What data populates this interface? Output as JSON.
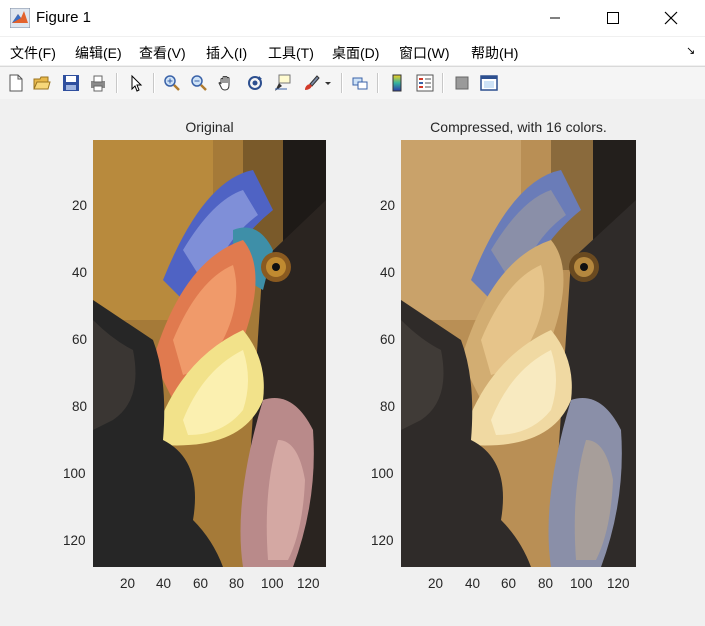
{
  "window": {
    "title": "Figure 1"
  },
  "menu": {
    "items": [
      "文件(F)",
      "编辑(E)",
      "查看(V)",
      "插入(I)",
      "工具(T)",
      "桌面(D)",
      "窗口(W)",
      "帮助(H)"
    ]
  },
  "toolbar": {
    "buttons": [
      "new-figure-icon",
      "open-file-icon",
      "save-icon",
      "print-icon",
      "select-arrow-icon",
      "zoom-in-icon",
      "zoom-out-icon",
      "pan-hand-icon",
      "rotate-3d-icon",
      "data-cursor-icon",
      "brush-icon",
      "link-plot-icon",
      "colorbar-icon",
      "legend-icon",
      "hide-plot-tools-icon",
      "show-plot-tools-icon"
    ]
  },
  "axes_left": {
    "title": "Original",
    "yticks": [
      "20",
      "40",
      "60",
      "80",
      "100",
      "120"
    ],
    "xticks": [
      "20",
      "40",
      "60",
      "80",
      "100",
      "120"
    ]
  },
  "axes_right": {
    "title": "Compressed, with 16 colors.",
    "yticks": [
      "20",
      "40",
      "60",
      "80",
      "100",
      "120"
    ],
    "xticks": [
      "20",
      "40",
      "60",
      "80",
      "100",
      "120"
    ]
  },
  "colors": {
    "original": {
      "bg_top": "#b88a3d",
      "beak_blue": "#5b6fc9",
      "beak_red": "#e07a4f",
      "beak_yellow": "#f2e28a",
      "dark": "#262626",
      "eye": "#c08a30",
      "pink": "#b98a8a"
    },
    "compressed": {
      "bg_top": "#c9a26a",
      "beak_blue": "#6a7cb8",
      "beak_light": "#f0d9a2",
      "beak_mid": "#d2ad72",
      "dark": "#2f2b29",
      "gray_blue": "#8a8fa8"
    }
  }
}
